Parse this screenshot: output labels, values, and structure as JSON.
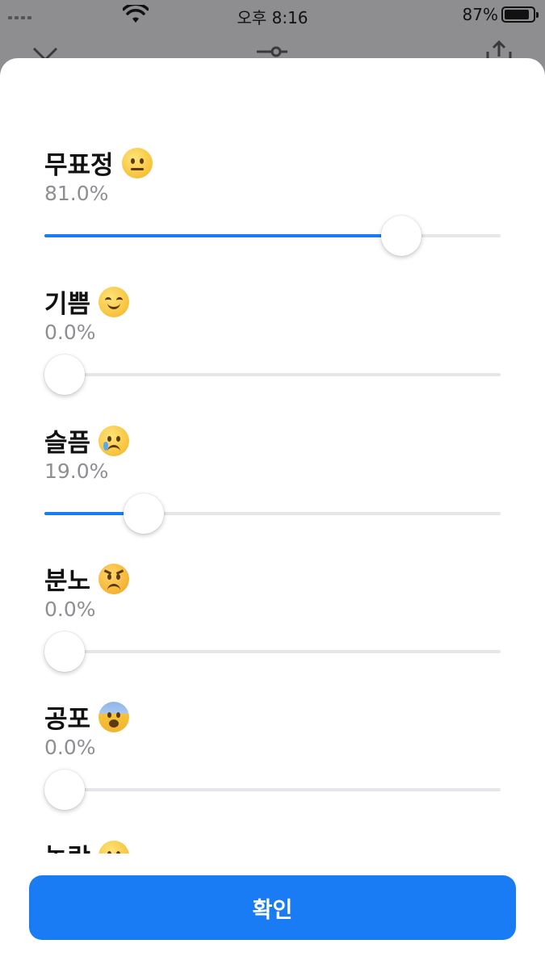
{
  "status_bar": {
    "time": "오후 8:16",
    "battery": "87%",
    "battery_level": 0.87
  },
  "background_toolbar": {
    "left_icon": "close-icon",
    "center_icon": "slider-icon",
    "right_icon": "share-icon"
  },
  "emotions": [
    {
      "label": "무표정",
      "emoji": "neutral-face-icon",
      "value_text": "81.0%",
      "value": 0.81
    },
    {
      "label": "기쁨",
      "emoji": "smiling-face-icon",
      "value_text": "0.0%",
      "value": 0.0
    },
    {
      "label": "슬픔",
      "emoji": "crying-face-icon",
      "value_text": "19.0%",
      "value": 0.19
    },
    {
      "label": "분노",
      "emoji": "angry-face-icon",
      "value_text": "0.0%",
      "value": 0.0
    },
    {
      "label": "공포",
      "emoji": "fearful-face-icon",
      "value_text": "0.0%",
      "value": 0.0
    },
    {
      "label": "놀람",
      "emoji": "surprised-face-icon"
    }
  ],
  "confirm_label": "확인",
  "colors": {
    "accent": "#1a7cf5",
    "track": "#e5e5ea",
    "value_text": "#8e8e93"
  }
}
